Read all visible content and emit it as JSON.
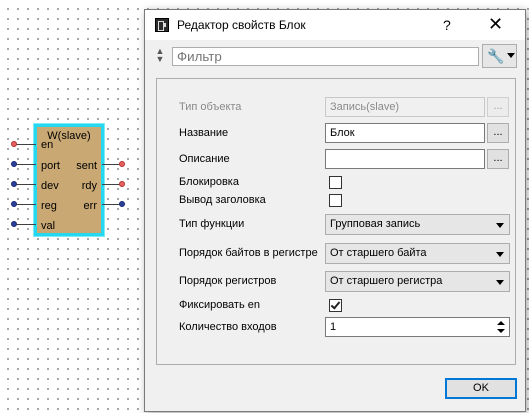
{
  "canvas": {
    "block": {
      "title": "W(slave)",
      "inputs": [
        "en",
        "port",
        "dev",
        "reg",
        "val"
      ],
      "outputs": [
        "sent",
        "rdy",
        "err"
      ],
      "colors": {
        "fill": "#c9a874",
        "selection": "#23d8f0"
      }
    }
  },
  "dialog": {
    "title": "Редактор свойств Блок",
    "help_label": "?",
    "close_label": "✕",
    "filter_placeholder": "Фильтр",
    "tool_icon": "wrench-icon",
    "properties": {
      "object_type": {
        "label": "Тип объекта",
        "value": "Запись(slave)",
        "button": "..."
      },
      "name": {
        "label": "Название",
        "value": "Блок",
        "button": "..."
      },
      "description": {
        "label": "Описание",
        "value": "",
        "button": "..."
      },
      "lock": {
        "label": "Блокировка",
        "checked": false
      },
      "show_header": {
        "label": "Вывод заголовка",
        "checked": false
      },
      "function_type": {
        "label": "Тип функции",
        "value": "Групповая запись"
      },
      "byte_order": {
        "label": "Порядок байтов в регистре",
        "value": "От старшего байта"
      },
      "register_order": {
        "label": "Порядок регистров",
        "value": "От старшего регистра"
      },
      "fix_en": {
        "label": "Фиксировать en",
        "checked": true
      },
      "input_count": {
        "label": "Количество входов",
        "value": "1"
      }
    },
    "ok_label": "OK",
    "colors": {
      "accent": "#0078d7"
    }
  }
}
